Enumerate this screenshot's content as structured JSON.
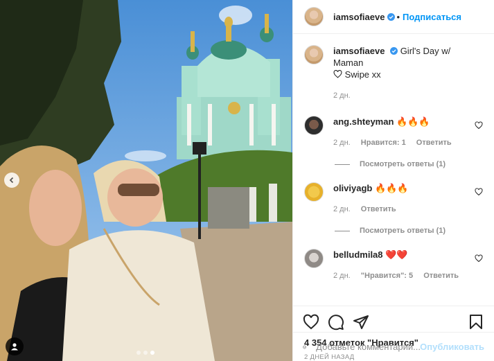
{
  "post": {
    "dots": [
      false,
      false,
      true
    ]
  },
  "header": {
    "username": "iamsofiaeve",
    "separator": "•",
    "follow_label": "Подписаться",
    "more_label": "•••"
  },
  "caption": {
    "username": "iamsofiaeve",
    "text": "Girl's Day w/ Maman",
    "text2": "Swipe xx",
    "time": "2 дн."
  },
  "comments": [
    {
      "username": "ang.shteyman",
      "text": "🔥🔥🔥",
      "time": "2 дн.",
      "likes": "Нравится: 1",
      "reply": "Ответить",
      "view_replies": "Посмотреть ответы (1)"
    },
    {
      "username": "oliviyagb",
      "text": "🔥🔥🔥",
      "time": "2 дн.",
      "reply": "Ответить",
      "view_replies": "Посмотреть ответы (1)"
    },
    {
      "username": "belludmila8",
      "text": "❤️❤️",
      "time": "2 дн.",
      "likes": "\"Нравится\": 5",
      "reply": "Ответить"
    }
  ],
  "likes_text": "4 354 отметок \"Нравится\"",
  "date_text": "2 ДНЕЙ НАЗАД",
  "add_comment": {
    "placeholder": "Добавьте комментарий...",
    "post_label": "Опубликовать"
  },
  "colors": {
    "accent": "#0095f6",
    "muted": "#8e8e8e",
    "post_disabled": "#b2dffc"
  }
}
